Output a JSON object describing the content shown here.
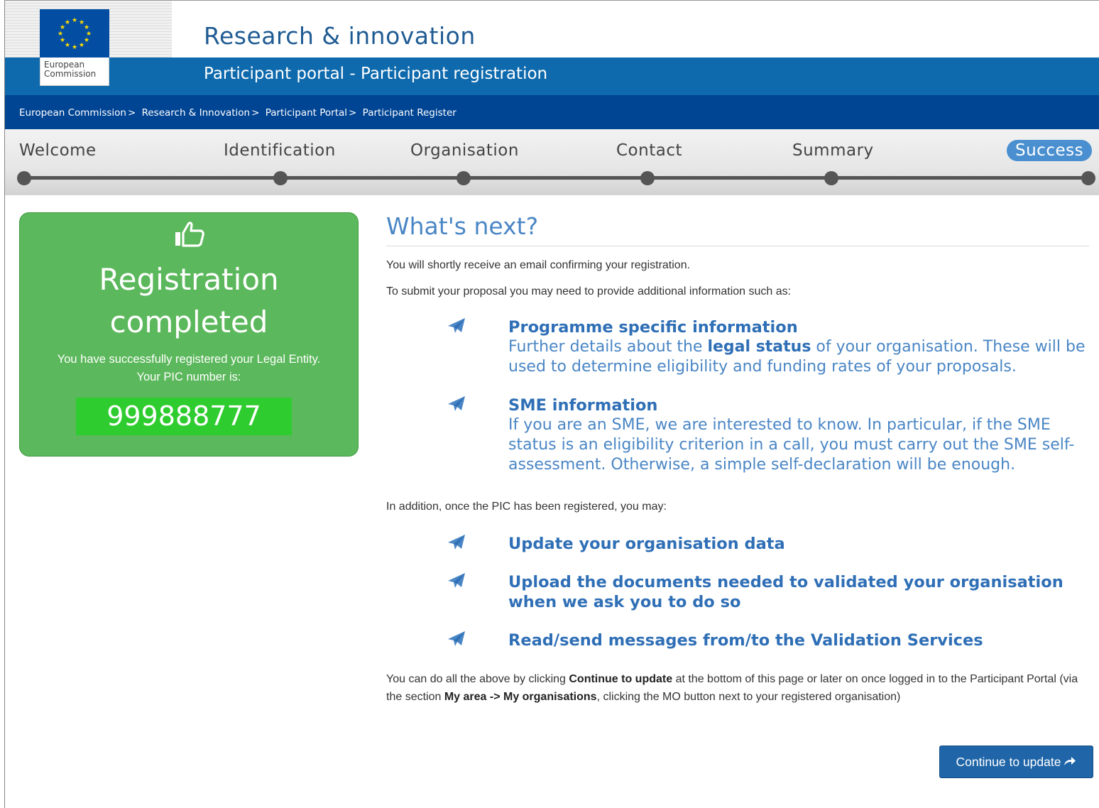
{
  "header": {
    "logo_line1": "European",
    "logo_line2": "Commission",
    "site_title": "Research & innovation",
    "portal_title": "Participant portal - Participant registration"
  },
  "breadcrumb": [
    "European Commission",
    "Research & Innovation",
    "Participant Portal",
    "Participant Register"
  ],
  "steps": [
    "Welcome",
    "Identification",
    "Organisation",
    "Contact",
    "Summary",
    "Success"
  ],
  "active_step": "Success",
  "success_card": {
    "title_line1": "Registration",
    "title_line2": "completed",
    "text_line1": "You have successfully registered your Legal Entity.",
    "text_line2": "Your PIC number is:",
    "pic_number": "999888777"
  },
  "main": {
    "title": "What's next?",
    "intro1": "You will shortly receive an email confirming your registration.",
    "intro2": "To submit your proposal you may need to provide additional information such as:",
    "items1": [
      {
        "head": "Programme specific information",
        "body_pre": "Further details about the ",
        "body_bold": "legal status",
        "body_post": " of your organisation. These will be used to determine eligibility and funding rates of your proposals."
      },
      {
        "head": "SME information",
        "body": "If you are an SME, we are interested to know. In particular, if the SME status is an eligibility criterion in a call, you must carry out the SME self-assessment. Otherwise, a simple self-declaration will be enough."
      }
    ],
    "addition": "In addition, once the PIC has been registered, you may:",
    "items2": [
      "Update your organisation data",
      "Upload the documents needed to validated your organisation when we ask you to do so",
      "Read/send messages from/to the Validation Services"
    ],
    "footer_pre": "You can do all the above by clicking ",
    "footer_b1": "Continue to update",
    "footer_mid": " at the bottom of this page or later on once logged in to the Participant Portal (via the section ",
    "footer_b2": "My area -> My organisations",
    "footer_post": ", clicking the MO button next to your registered organisation)",
    "continue_label": "Continue to update"
  }
}
